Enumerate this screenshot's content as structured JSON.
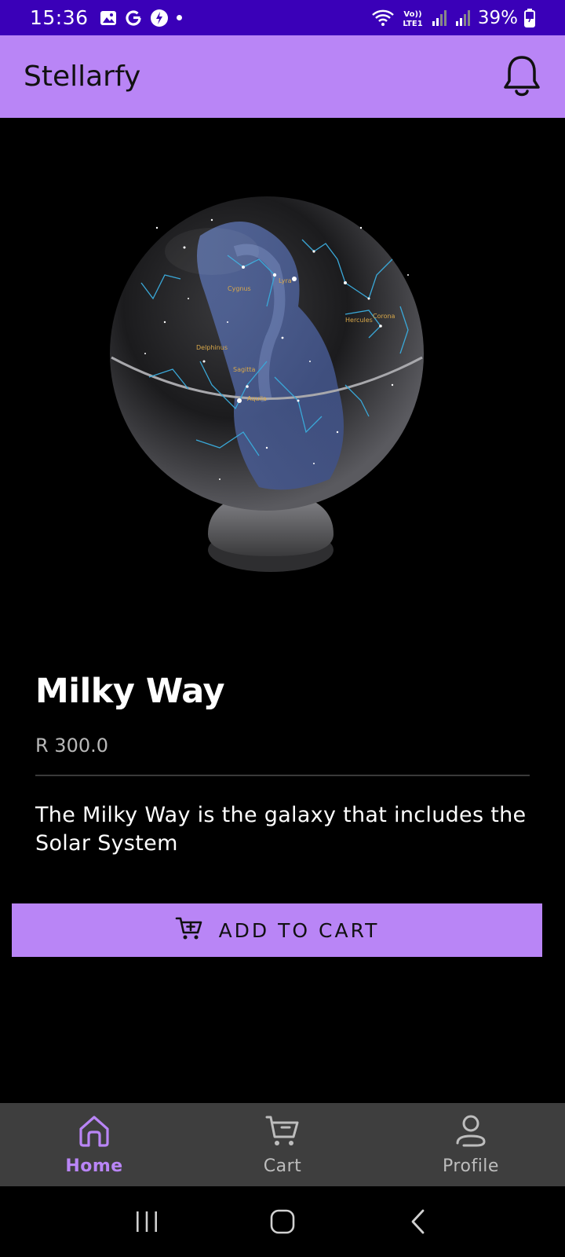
{
  "status_bar": {
    "time": "15:36",
    "battery": "39%",
    "network_label": "Vo)) LTE1"
  },
  "app_bar": {
    "title": "Stellarfy",
    "notification_icon": "bell-icon"
  },
  "product": {
    "name": "Milky Way",
    "price": "R 300.0",
    "description": "The Milky Way is the galaxy that includes the Solar System",
    "image": "star-globe"
  },
  "add_to_cart": {
    "label": "ADD TO CART",
    "icon": "cart-plus-icon"
  },
  "bottom_nav": {
    "items": [
      {
        "label": "Home",
        "icon": "home-icon",
        "active": true
      },
      {
        "label": "Cart",
        "icon": "cart-icon",
        "active": false
      },
      {
        "label": "Profile",
        "icon": "profile-icon",
        "active": false
      }
    ]
  },
  "colors": {
    "status_bar": "#3a00b8",
    "accent": "#b985f6",
    "nav_bg": "#3e3e3e",
    "background": "#000000"
  }
}
